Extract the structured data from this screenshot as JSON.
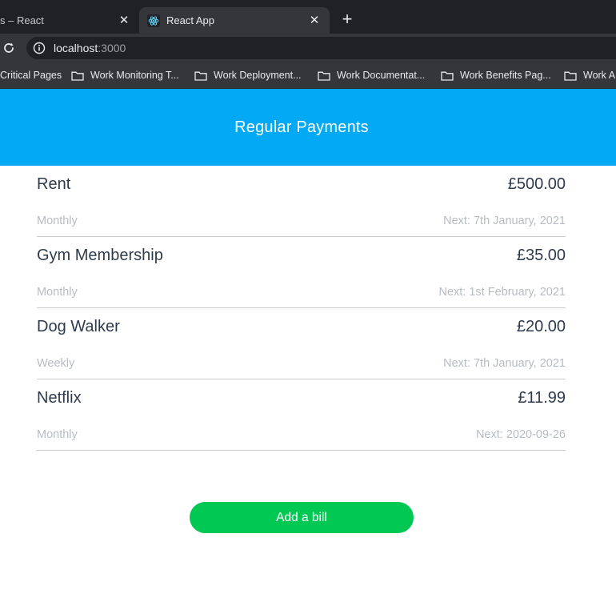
{
  "browser": {
    "tabs": [
      {
        "title": "s – React",
        "active": false
      },
      {
        "title": "React App",
        "active": true
      }
    ],
    "close_symbol": "✕",
    "new_tab_symbol": "+",
    "url_host": "localhost",
    "url_port": ":3000",
    "bookmarks": [
      {
        "label": "Critical Pages",
        "icon": "none"
      },
      {
        "label": "Work Monitoring T...",
        "icon": "folder-icon"
      },
      {
        "label": "Work Deployment...",
        "icon": "folder-icon"
      },
      {
        "label": "Work Documentat...",
        "icon": "folder-icon"
      },
      {
        "label": "Work Benefits Pag...",
        "icon": "folder-icon"
      },
      {
        "label": "Work A",
        "icon": "folder-icon"
      }
    ]
  },
  "app": {
    "title": "Regular Payments",
    "header_color": "#03a9f4",
    "bills": [
      {
        "name": "Rent",
        "amount": "£500.00",
        "frequency": "Monthly",
        "next": "Next: 7th January, 2021"
      },
      {
        "name": "Gym Membership",
        "amount": "£35.00",
        "frequency": "Monthly",
        "next": "Next: 1st February, 2021"
      },
      {
        "name": "Dog Walker",
        "amount": "£20.00",
        "frequency": "Weekly",
        "next": "Next: 7th January, 2021"
      },
      {
        "name": "Netflix",
        "amount": "£11.99",
        "frequency": "Monthly",
        "next": "Next: 2020-09-26"
      }
    ],
    "add_button_label": "Add a bill",
    "add_button_color": "#00c853"
  }
}
